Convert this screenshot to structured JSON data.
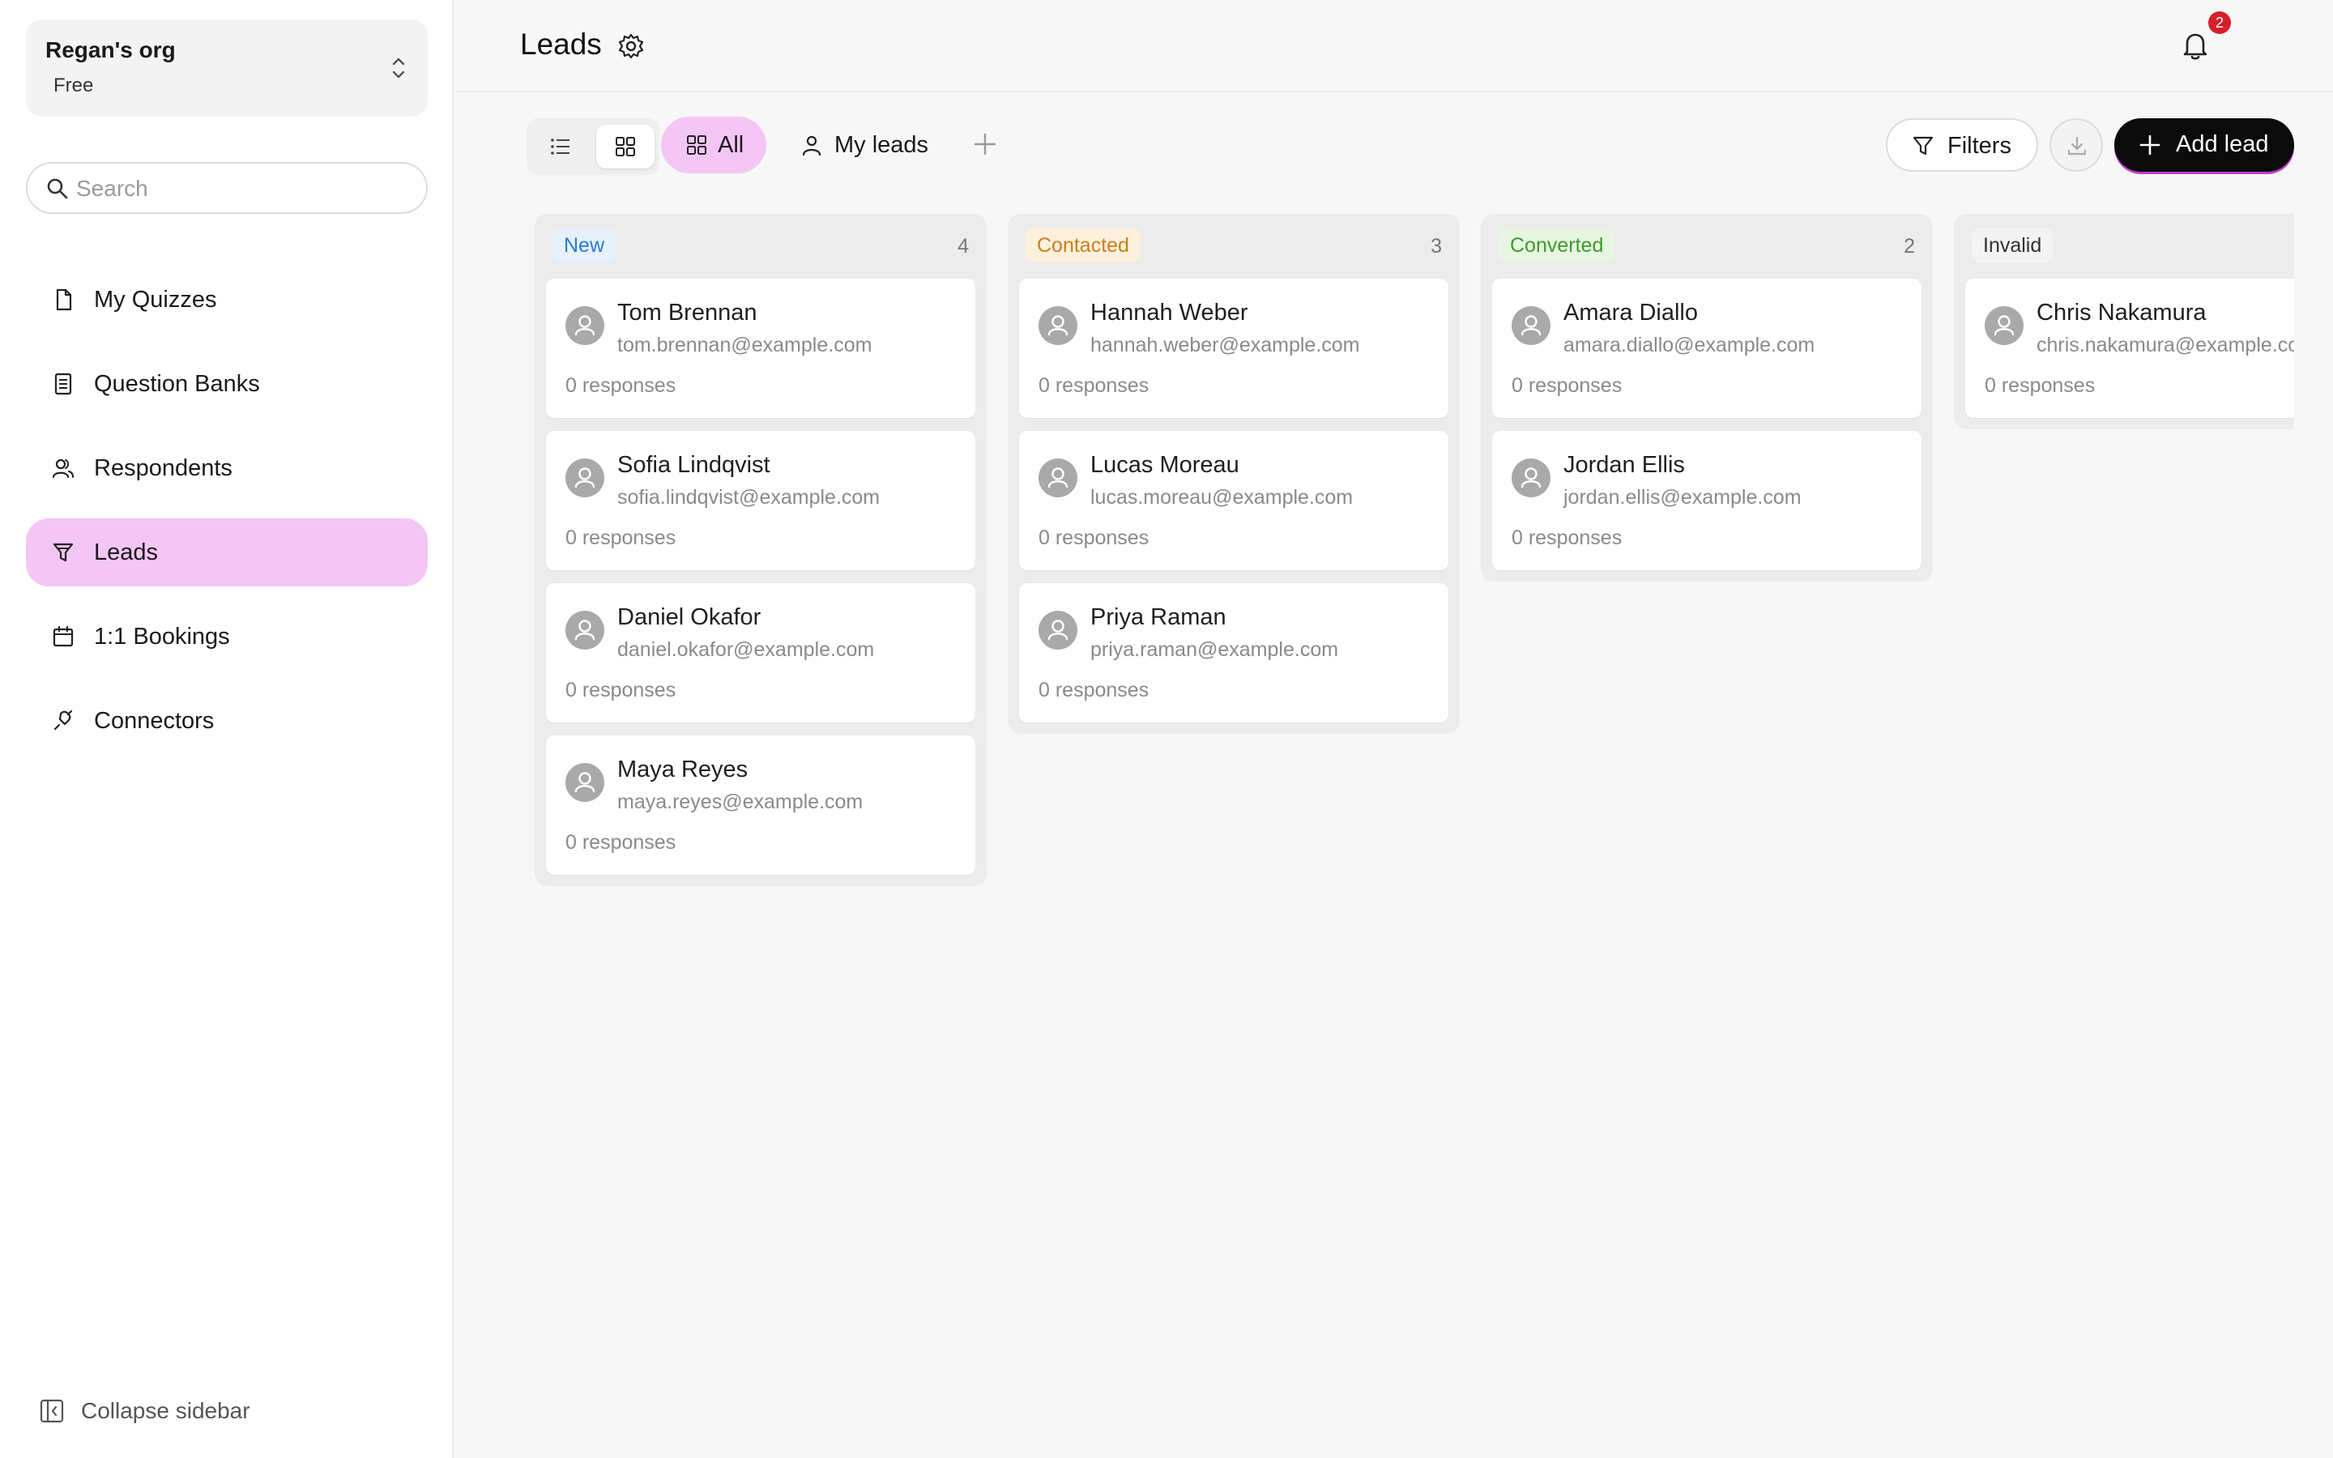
{
  "sidebar": {
    "org_name": "Regan's org",
    "org_plan": "Free",
    "search_placeholder": "Search",
    "items": [
      {
        "label": "My Quizzes",
        "icon": "document-icon",
        "active": false
      },
      {
        "label": "Question Banks",
        "icon": "list-icon",
        "active": false
      },
      {
        "label": "Respondents",
        "icon": "users-icon",
        "active": false
      },
      {
        "label": "Leads",
        "icon": "funnel-icon",
        "active": true
      },
      {
        "label": "1:1 Bookings",
        "icon": "calendar-icon",
        "active": false
      },
      {
        "label": "Connectors",
        "icon": "plug-icon",
        "active": false
      }
    ],
    "collapse_label": "Collapse sidebar"
  },
  "header": {
    "title": "Leads",
    "notification_count": "2"
  },
  "toolbar": {
    "tab_all": "All",
    "tab_my_leads": "My leads",
    "filters_label": "Filters",
    "add_lead_label": "Add lead"
  },
  "board": {
    "columns": [
      {
        "label": "New",
        "count": "4",
        "leads": [
          {
            "name": "Tom Brennan",
            "email": "tom.brennan@example.com",
            "responses": "0 responses"
          },
          {
            "name": "Sofia Lindqvist",
            "email": "sofia.lindqvist@example.com",
            "responses": "0 responses"
          },
          {
            "name": "Daniel Okafor",
            "email": "daniel.okafor@example.com",
            "responses": "0 responses"
          },
          {
            "name": "Maya Reyes",
            "email": "maya.reyes@example.com",
            "responses": "0 responses"
          }
        ]
      },
      {
        "label": "Contacted",
        "count": "3",
        "leads": [
          {
            "name": "Hannah Weber",
            "email": "hannah.weber@example.com",
            "responses": "0 responses"
          },
          {
            "name": "Lucas Moreau",
            "email": "lucas.moreau@example.com",
            "responses": "0 responses"
          },
          {
            "name": "Priya Raman",
            "email": "priya.raman@example.com",
            "responses": "0 responses"
          }
        ]
      },
      {
        "label": "Converted",
        "count": "2",
        "leads": [
          {
            "name": "Amara Diallo",
            "email": "amara.diallo@example.com",
            "responses": "0 responses"
          },
          {
            "name": "Jordan Ellis",
            "email": "jordan.ellis@example.com",
            "responses": "0 responses"
          }
        ]
      },
      {
        "label": "Invalid",
        "count": "",
        "leads": [
          {
            "name": "Chris Nakamura",
            "email": "chris.nakamura@example.com",
            "responses": "0 responses"
          }
        ]
      }
    ]
  },
  "colors": {
    "accent_pink": "#f4c6f6",
    "new_badge_bg": "#e6f1fb",
    "new_badge_text": "#2a7bd0",
    "contacted_badge_bg": "#fdf0dc",
    "contacted_badge_text": "#c8801a",
    "converted_badge_bg": "#e6f6e2",
    "converted_badge_text": "#3f9a2a",
    "invalid_badge_bg": "#f3f3f3",
    "invalid_badge_text": "#333333",
    "notification_badge": "#d31f2b"
  }
}
